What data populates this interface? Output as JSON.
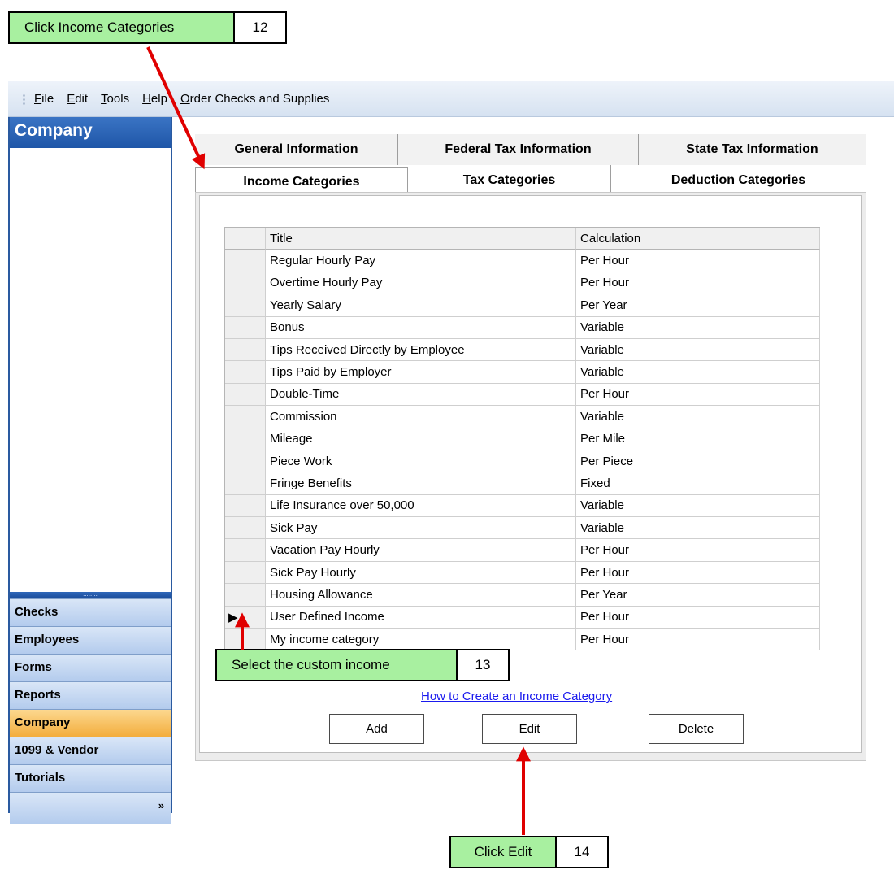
{
  "callouts": [
    {
      "text": "Click Income Categories",
      "number": "12"
    },
    {
      "text": "Select the custom income",
      "number": "13"
    },
    {
      "text": "Click Edit",
      "number": "14"
    }
  ],
  "menu": {
    "grip": "⋮",
    "items": [
      {
        "key": "F",
        "rest": "ile"
      },
      {
        "key": "E",
        "rest": "dit"
      },
      {
        "key": "T",
        "rest": "ools"
      },
      {
        "key": "H",
        "rest": "elp"
      },
      {
        "key": "O",
        "rest": "rder Checks and Supplies"
      }
    ]
  },
  "nav": {
    "title": "Company",
    "grip": "........",
    "buttons": [
      "Checks",
      "Employees",
      "Forms",
      "Reports",
      "Company",
      "1099 & Vendor",
      "Tutorials"
    ],
    "active": "Company",
    "footer_glyph": "»"
  },
  "tabs": {
    "back_row": [
      "General Information",
      "Federal Tax Information",
      "State Tax Information"
    ],
    "front_row": [
      "Income Categories",
      "Tax Categories",
      "Deduction Categories"
    ],
    "selected": "Income Categories"
  },
  "grid": {
    "headers": {
      "title": "Title",
      "calculation": "Calculation"
    },
    "current_row_marker": "▶",
    "rows": [
      {
        "title": "Regular Hourly Pay",
        "calculation": "Per Hour"
      },
      {
        "title": "Overtime Hourly Pay",
        "calculation": "Per Hour"
      },
      {
        "title": "Yearly Salary",
        "calculation": "Per Year"
      },
      {
        "title": "Bonus",
        "calculation": "Variable"
      },
      {
        "title": "Tips Received Directly by Employee",
        "calculation": "Variable"
      },
      {
        "title": "Tips Paid by Employer",
        "calculation": "Variable"
      },
      {
        "title": "Double-Time",
        "calculation": "Per Hour"
      },
      {
        "title": "Commission",
        "calculation": "Variable"
      },
      {
        "title": "Mileage",
        "calculation": "Per Mile"
      },
      {
        "title": "Piece Work",
        "calculation": "Per Piece"
      },
      {
        "title": "Fringe Benefits",
        "calculation": "Fixed"
      },
      {
        "title": "Life Insurance over 50,000",
        "calculation": "Variable"
      },
      {
        "title": "Sick Pay",
        "calculation": "Variable"
      },
      {
        "title": "Vacation Pay Hourly",
        "calculation": "Per Hour"
      },
      {
        "title": "Sick Pay Hourly",
        "calculation": "Per Hour"
      },
      {
        "title": "Housing Allowance",
        "calculation": "Per Year"
      },
      {
        "title": "User Defined Income",
        "calculation": "Per Hour",
        "current": true
      },
      {
        "title": "My income category",
        "calculation": "Per Hour"
      }
    ]
  },
  "link_text": "How to Create an Income Category",
  "buttons": {
    "add": "Add",
    "edit": "Edit",
    "delete": "Delete"
  },
  "colors": {
    "callout_bg": "#a8f0a0",
    "arrow": "#e00000",
    "nav_active": "#f3ad3c",
    "link": "#1a1aee"
  }
}
